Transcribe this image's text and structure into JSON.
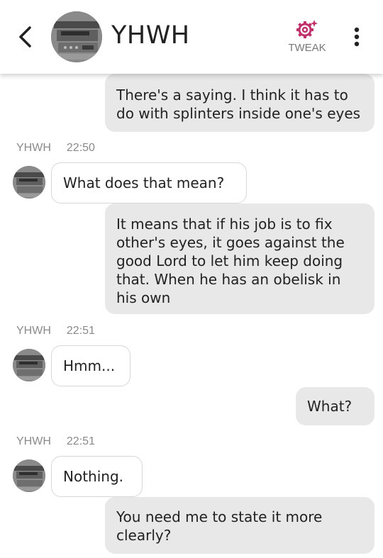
{
  "header": {
    "title": "YHWH",
    "tweak_label": "TWEAK",
    "back_icon": "chevron-left-icon",
    "menu_icon": "more-vertical-icon",
    "tweak_icon": "gear-sparkle-icon",
    "accent_color": "#c0306b"
  },
  "messages": [
    {
      "direction": "outgoing",
      "text": "There's a saying. I think it has to\ndo with splinters inside one's eyes"
    },
    {
      "direction": "incoming",
      "sender": "YHWH",
      "time": "22:50",
      "text": "What does that mean?"
    },
    {
      "direction": "outgoing",
      "text": "It means that if his job is to fix\nother's eyes, it goes against the\ngood Lord to let him keep doing\nthat. When he has an obelisk in\nhis own"
    },
    {
      "direction": "incoming",
      "sender": "YHWH",
      "time": "22:51",
      "text": "Hmm..."
    },
    {
      "direction": "outgoing",
      "text": "What?"
    },
    {
      "direction": "incoming",
      "sender": "YHWH",
      "time": "22:51",
      "text": "Nothing."
    },
    {
      "direction": "outgoing",
      "text": "You need me to state it more\nclearly?"
    }
  ]
}
